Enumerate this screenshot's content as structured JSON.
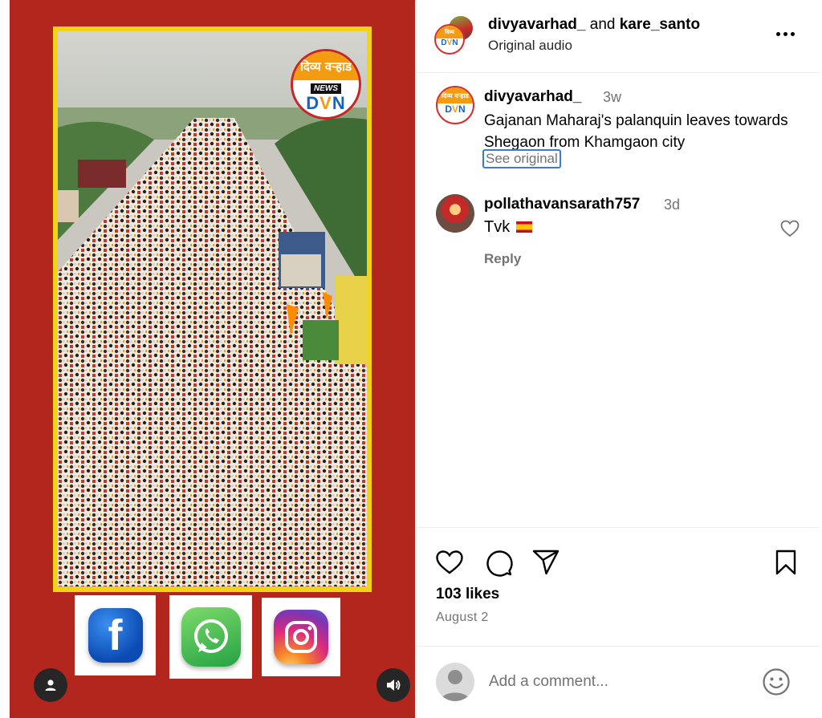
{
  "header": {
    "user1": "divyavarhad_",
    "joiner": "and",
    "user2": "kare_santo",
    "audio": "Original audio"
  },
  "video": {
    "logo_top": "दिव्य वऱ्हाड",
    "logo_news": "NEWS",
    "logo_dvn_d": "D",
    "logo_dvn_v": "V",
    "logo_dvn_n": "N"
  },
  "caption": {
    "username": "divyavarhad_",
    "time": "3w",
    "text": "Gajanan Maharaj's palanquin leaves towards Shegaon from Khamgaon city",
    "see_original": "See original"
  },
  "comments": [
    {
      "username": "pollathavansarath757",
      "time": "3d",
      "text": "Tvk",
      "reply_label": "Reply"
    }
  ],
  "stats": {
    "likes": "103 likes",
    "date": "August 2"
  },
  "composer": {
    "placeholder": "Add a comment..."
  },
  "icons": {
    "like": "heart-icon",
    "comment": "comment-icon",
    "share": "share-icon",
    "save": "bookmark-icon",
    "more": "more-icon",
    "emoji": "emoji-icon",
    "user": "user-icon",
    "audio": "speaker-icon"
  },
  "colors": {
    "media_background": "#b3261e",
    "video_border": "#f2d21a",
    "link_focus": "#3b7bd8",
    "muted_text": "#737373"
  }
}
